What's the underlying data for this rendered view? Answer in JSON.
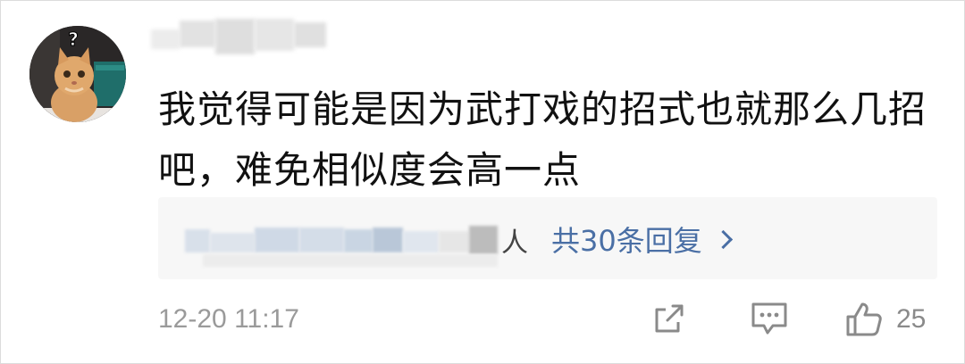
{
  "comment": {
    "text_line1": "我觉得可能是因为武打戏的招式也就那么几招",
    "text_line2": "吧，难免相似度会高一点"
  },
  "replies": {
    "people_suffix": "人",
    "link_label": "共30条回复"
  },
  "footer": {
    "timestamp": "12-20 11:17",
    "like_count": "25"
  },
  "icons": {
    "share": "share-icon",
    "comment": "comment-icon",
    "like": "thumbs-up-icon"
  },
  "colors": {
    "link": "#4a6fa5",
    "meta": "#9a9a9a",
    "text": "#111111"
  }
}
